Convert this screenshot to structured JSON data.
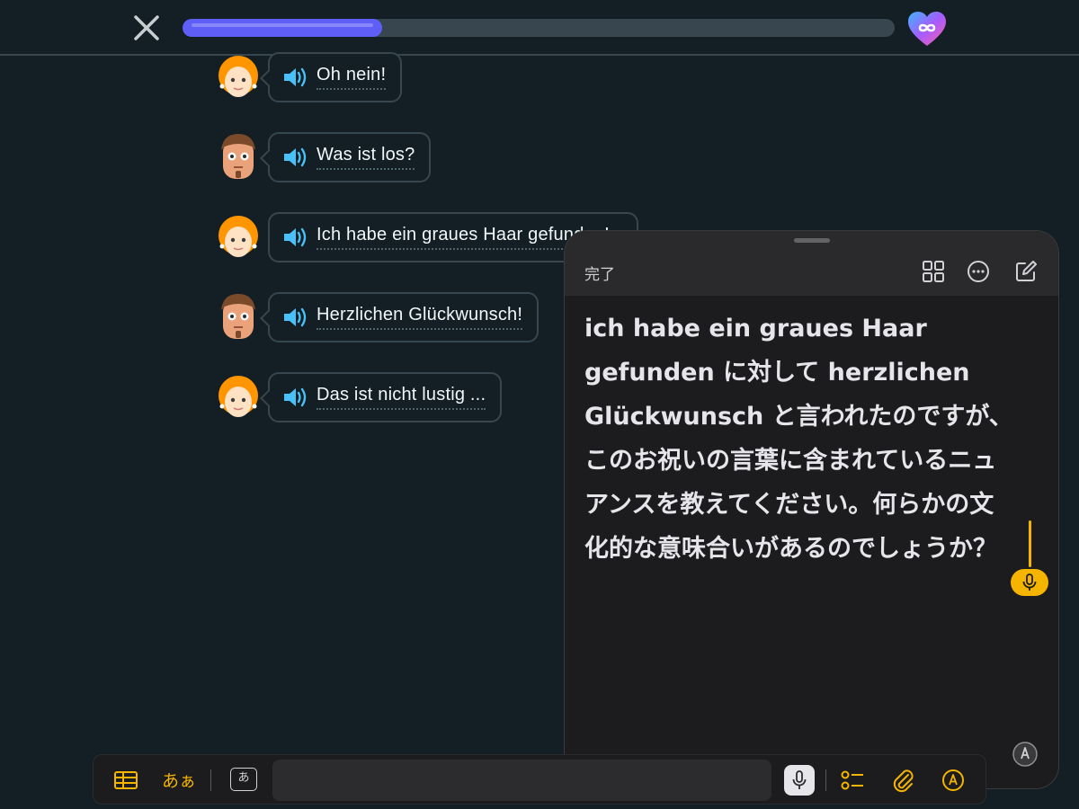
{
  "progress": {
    "value": 0.28
  },
  "lesson": {
    "messages": [
      {
        "speaker": "woman",
        "text": "Oh nein!"
      },
      {
        "speaker": "man",
        "text": "Was ist los?"
      },
      {
        "speaker": "woman",
        "text": "Ich habe ein graues Haar gefunden!"
      },
      {
        "speaker": "man",
        "text": "Herzlichen Glückwunsch!"
      },
      {
        "speaker": "woman",
        "text": "Das ist nicht lustig ..."
      }
    ]
  },
  "notes": {
    "done_label": "完了",
    "body_lines": [
      "ich habe ein graues Haar",
      "gefunden に対して herzlichen",
      "Glückwunsch と言われたのですが、",
      "このお祝いの言葉に含まれているニュ",
      "アンスを教えてください。何らかの文",
      "化的な意味合いがあるのでしょうか？"
    ]
  },
  "toolbar": {
    "text_style_label": "あぁ",
    "keyboard_label": "あ"
  },
  "colors": {
    "background": "#131f24",
    "progress_fill": "#5f5ff8",
    "speaker_blue": "#49c0f8",
    "accent_yellow": "#f4b400"
  },
  "icons": {
    "close": "close-icon",
    "hearts": "infinite-hearts-icon",
    "speaker": "speaker-icon",
    "grid": "grid-icon",
    "more": "more-icon",
    "compose": "compose-icon",
    "table": "table-icon",
    "mic": "microphone-icon",
    "checklist": "checklist-icon",
    "attach": "paperclip-icon",
    "markup": "markup-icon"
  }
}
